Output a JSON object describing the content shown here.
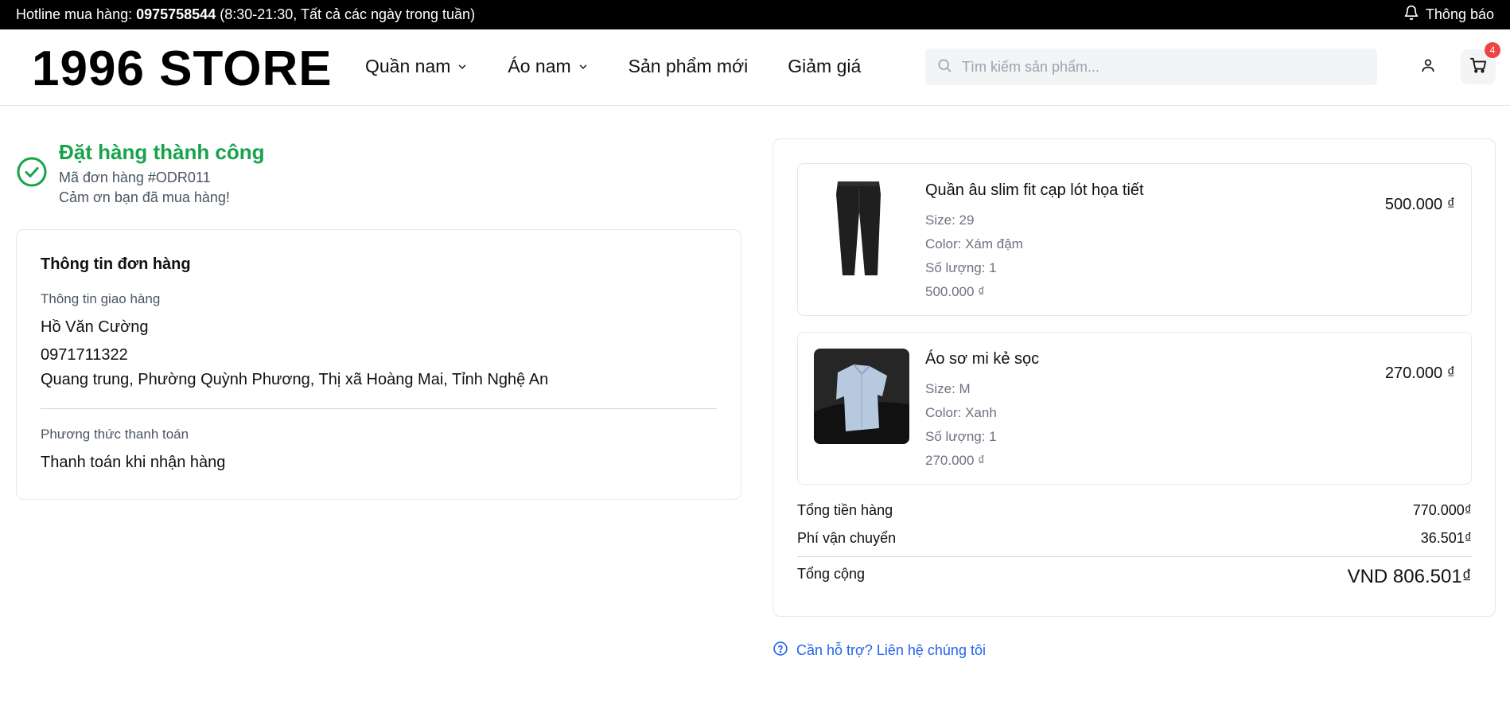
{
  "topbar": {
    "hotline_prefix": "Hotline mua hàng: ",
    "hotline_number": "0975758544",
    "hotline_hours": " (8:30-21:30, Tất cả các ngày trong tuần)",
    "notification_label": "Thông báo"
  },
  "header": {
    "logo": "1996 STORE",
    "nav": [
      {
        "label": "Quần nam",
        "has_dropdown": true
      },
      {
        "label": "Áo nam",
        "has_dropdown": true
      },
      {
        "label": "Sản phẩm mới",
        "has_dropdown": false
      },
      {
        "label": "Giảm giá",
        "has_dropdown": false
      }
    ],
    "search_placeholder": "Tìm kiếm sản phẩm...",
    "cart_count": "4"
  },
  "success": {
    "title": "Đặt hàng thành công",
    "order_code": "Mã đơn hàng #ODR011",
    "thanks": "Cảm ơn bạn đã mua hàng!"
  },
  "order_info": {
    "title": "Thông tin đơn hàng",
    "shipping_label": "Thông tin giao hàng",
    "name": "Hồ Văn Cường",
    "phone": "0971711322",
    "address": "Quang trung, Phường Quỳnh Phương, Thị xã Hoàng Mai, Tỉnh Nghệ An",
    "payment_label": "Phương thức thanh toán",
    "payment_method": "Thanh toán khi nhận hàng"
  },
  "items": [
    {
      "name": "Quần âu slim fit cạp lót họa tiết",
      "size": "Size: 29",
      "color": "Color: Xám đậm",
      "quantity": "Số lượng: 1",
      "unit_price": "500.000 ₫",
      "price": "500.000 ₫"
    },
    {
      "name": "Áo sơ mi kẻ sọc",
      "size": "Size: M",
      "color": "Color: Xanh",
      "quantity": "Số lượng: 1",
      "unit_price": "270.000 ₫",
      "price": "270.000 ₫"
    }
  ],
  "summary": {
    "subtotal_label": "Tổng tiền hàng",
    "subtotal_value": "770.000₫",
    "shipping_label": "Phí vận chuyển",
    "shipping_value": "36.501₫",
    "total_label": "Tổng cộng",
    "total_value": "VND 806.501₫"
  },
  "help_text": "Cần hỗ trợ? Liên hệ chúng tôi",
  "colors": {
    "success": "#16a34a",
    "link": "#2563eb",
    "badge": "#ef4444"
  }
}
